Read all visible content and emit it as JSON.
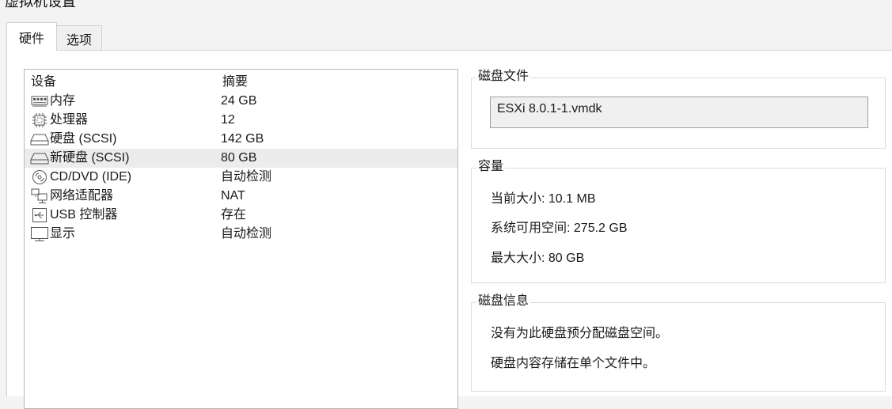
{
  "window": {
    "title": "虚拟机设置"
  },
  "tabs": [
    {
      "label": "硬件",
      "active": true
    },
    {
      "label": "选项",
      "active": false
    }
  ],
  "device_list": {
    "columns": {
      "device": "设备",
      "summary": "摘要"
    },
    "rows": [
      {
        "device": "内存",
        "summary": "24 GB",
        "icon": "memory-icon",
        "selected": false
      },
      {
        "device": "处理器",
        "summary": "12",
        "icon": "processor-icon",
        "selected": false
      },
      {
        "device": "硬盘 (SCSI)",
        "summary": "142 GB",
        "icon": "hard-disk-icon",
        "selected": false
      },
      {
        "device": "新硬盘 (SCSI)",
        "summary": "80 GB",
        "icon": "hard-disk-icon",
        "selected": true
      },
      {
        "device": "CD/DVD (IDE)",
        "summary": "自动检测",
        "icon": "cd-dvd-icon",
        "selected": false
      },
      {
        "device": "网络适配器",
        "summary": "NAT",
        "icon": "network-adapter-icon",
        "selected": false
      },
      {
        "device": "USB 控制器",
        "summary": "存在",
        "icon": "usb-controller-icon",
        "selected": false
      },
      {
        "device": "显示",
        "summary": "自动检测",
        "icon": "display-icon",
        "selected": false
      }
    ]
  },
  "disk_file": {
    "title": "磁盘文件",
    "value": "ESXi 8.0.1-1.vmdk"
  },
  "capacity": {
    "title": "容量",
    "current_size_label": "当前大小:",
    "current_size_value": "10.1 MB",
    "available_label": "系统可用空间:",
    "available_value": "275.2 GB",
    "max_size_label": "最大大小:",
    "max_size_value": "80 GB"
  },
  "disk_info": {
    "title": "磁盘信息",
    "line1": "没有为此硬盘预分配磁盘空间。",
    "line2": "硬盘内容存储在单个文件中。"
  },
  "colors": {
    "selected_row": "#ececec",
    "panel_bg": "#ffffff",
    "window_bg": "#f3f3f3"
  }
}
